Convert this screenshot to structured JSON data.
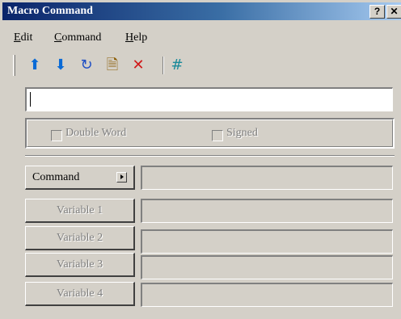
{
  "window": {
    "title": "Macro Command",
    "help_button": "?",
    "close_button": "✕"
  },
  "menu": {
    "items": [
      {
        "u": "E",
        "rest": "dit"
      },
      {
        "u": "C",
        "rest": "ommand"
      },
      {
        "u": "H",
        "rest": "elp"
      }
    ]
  },
  "toolbar": {
    "icons": [
      {
        "name": "move-up-icon",
        "glyph": "⬆",
        "color": "#0a6ad6"
      },
      {
        "name": "move-down-icon",
        "glyph": "⬇",
        "color": "#0a6ad6"
      },
      {
        "name": "refresh-icon",
        "glyph": "↻",
        "color": "#1f4fc4"
      },
      {
        "name": "edit-document-icon",
        "glyph": "🗎",
        "color": "#8a5a00"
      },
      {
        "name": "delete-icon",
        "glyph": "✕",
        "color": "#d01818"
      }
    ],
    "hash": {
      "name": "hash-icon",
      "glyph": "#",
      "color": "#1a8a9a"
    }
  },
  "command_input": {
    "value": ""
  },
  "options": {
    "double_word_label": "Double Word",
    "signed_label": "Signed"
  },
  "command_button": {
    "label": "Command"
  },
  "variables": [
    {
      "label": "Variable 1",
      "value": ""
    },
    {
      "label": "Variable 2",
      "value": ""
    },
    {
      "label": "Variable 3",
      "value": ""
    },
    {
      "label": "Variable 4",
      "value": ""
    }
  ]
}
